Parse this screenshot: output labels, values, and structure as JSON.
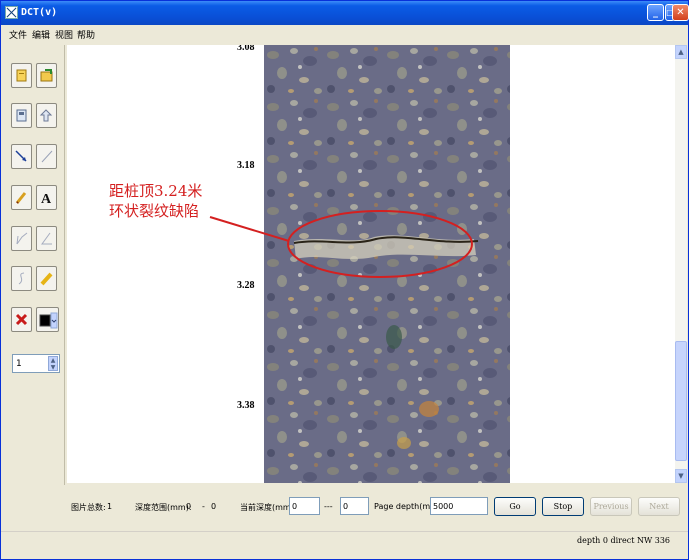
{
  "window": {
    "title": "DCT(v)"
  },
  "menu": {
    "items": [
      "文件",
      "编辑",
      "视图",
      "帮助"
    ]
  },
  "tools": {
    "line_width_value": "1",
    "icons": [
      "new-file-icon",
      "open-file-icon",
      "save-icon",
      "export-icon",
      "arrow-line-icon",
      "line-icon",
      "pencil-icon",
      "text-icon",
      "angle-line-icon",
      "angle-icon",
      "curve-icon",
      "highlighter-icon",
      "delete-icon",
      "color-picker-icon"
    ],
    "text_tool_glyph": "A",
    "color_swatch": "#000000"
  },
  "image": {
    "depth_labels": [
      "3.08",
      "3.18",
      "3.28",
      "3.38"
    ],
    "annotation": {
      "line1": "距桩顶3.24米",
      "line2": "环状裂纹缺陷"
    },
    "annotation_color": "#d42020"
  },
  "bottom": {
    "total_images_label": "图片总数:",
    "total_images_value": "1",
    "depth_range_label": "深度范围(mm):",
    "depth_range_from": "0",
    "depth_range_sep": "-",
    "depth_range_to": "0",
    "current_depth_label": "当前深度(mm):",
    "current_depth_from": "0",
    "current_depth_sep": "---",
    "current_depth_to": "0",
    "page_depth_label": "Page depth(mm):",
    "page_depth_value": "5000",
    "go_label": "Go",
    "stop_label": "Stop",
    "previous_label": "Previous",
    "next_label": "Next"
  },
  "status": {
    "text": "depth 0  direct NW 336"
  }
}
